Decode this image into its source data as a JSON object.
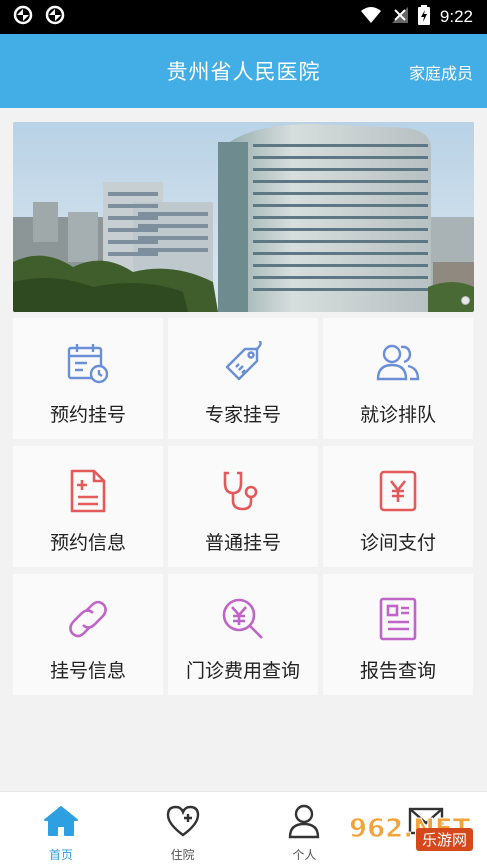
{
  "status_bar": {
    "time": "9:22"
  },
  "header": {
    "title": "贵州省人民医院",
    "right_link": "家庭成员"
  },
  "tiles": [
    {
      "label": "预约挂号",
      "icon": "calendar-clock-icon",
      "color": "#6b8fd6"
    },
    {
      "label": "专家挂号",
      "icon": "price-tag-icon",
      "color": "#6b8fd6"
    },
    {
      "label": "就诊排队",
      "icon": "people-icon",
      "color": "#6b8fd6"
    },
    {
      "label": "预约信息",
      "icon": "document-plus-icon",
      "color": "#e45a5a"
    },
    {
      "label": "普通挂号",
      "icon": "stethoscope-icon",
      "color": "#e45a5a"
    },
    {
      "label": "诊间支付",
      "icon": "yen-bill-icon",
      "color": "#e45a5a"
    },
    {
      "label": "挂号信息",
      "icon": "link-icon",
      "color": "#c065c8"
    },
    {
      "label": "门诊费用查询",
      "icon": "yen-search-icon",
      "color": "#c065c8"
    },
    {
      "label": "报告查询",
      "icon": "report-icon",
      "color": "#c065c8"
    }
  ],
  "bottom_nav": [
    {
      "label": "首页",
      "icon": "home-icon",
      "active": true
    },
    {
      "label": "住院",
      "icon": "heart-plus-icon",
      "active": false
    },
    {
      "label": "个人",
      "icon": "person-icon",
      "active": false
    },
    {
      "label": "",
      "icon": "mail-icon",
      "active": false
    }
  ],
  "watermark": {
    "text": "962.NET",
    "subtext": "乐游网"
  },
  "colors": {
    "header": "#43aee6",
    "nav_active": "#2e9fe0"
  }
}
